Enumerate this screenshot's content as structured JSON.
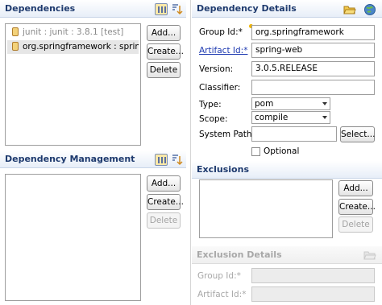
{
  "dependencies": {
    "title": "Dependencies",
    "items": [
      {
        "label": "junit : junit : 3.8.1 [test]"
      },
      {
        "label": "org.springframework : sprin..."
      }
    ],
    "add_label": "Add...",
    "create_label": "Create...",
    "delete_label": "Delete"
  },
  "dependency_management": {
    "title": "Dependency Management",
    "add_label": "Add...",
    "create_label": "Create...",
    "delete_label": "Delete"
  },
  "dependency_details": {
    "title": "Dependency Details",
    "group_id_label": "Group Id:*",
    "group_id_value": "org.springframework",
    "artifact_id_label": "Artifact Id:*",
    "artifact_id_value": "spring-web",
    "version_label": "Version:",
    "version_value": "3.0.5.RELEASE",
    "classifier_label": "Classifier:",
    "classifier_value": "",
    "type_label": "Type:",
    "type_value": "pom",
    "scope_label": "Scope:",
    "scope_value": "compile",
    "system_path_label": "System Path:",
    "system_path_value": "",
    "select_label": "Select...",
    "optional_label": "Optional",
    "optional_checked": false
  },
  "exclusions": {
    "title": "Exclusions",
    "add_label": "Add...",
    "create_label": "Create...",
    "delete_label": "Delete"
  },
  "exclusion_details": {
    "title": "Exclusion Details",
    "group_id_label": "Group Id:*",
    "artifact_id_label": "Artifact Id:*"
  },
  "colors": {
    "section_title": "#1e3a6e",
    "link": "#1d39b0",
    "required_marker": "#f0b400"
  }
}
